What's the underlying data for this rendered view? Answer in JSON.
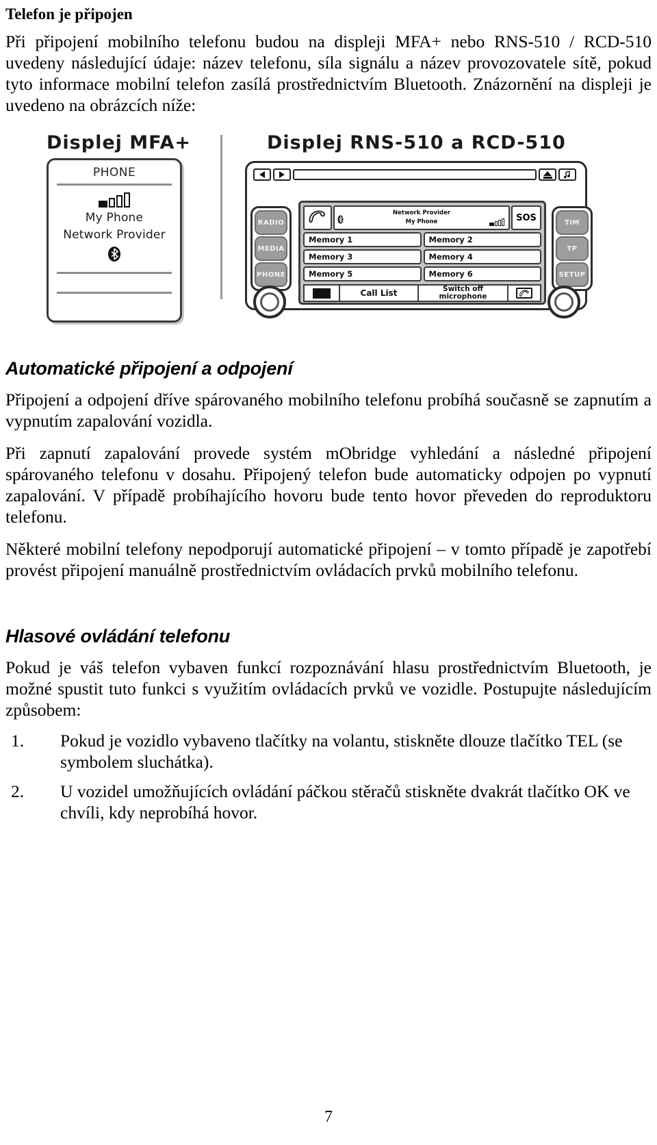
{
  "document": {
    "heading": "Telefon je připojen",
    "intro_paragraph": "Při připojení mobilního telefonu budou na displeji MFA+ nebo  RNS-510 / RCD-510 uvedeny následující údaje: název telefonu, síla signálu a název provozovatele sítě, pokud tyto informace mobilní telefon zasílá prostřednictvím Bluetooth. Znázornění na displeji je uvedeno na obrázcích níže:",
    "page_number": "7"
  },
  "figure": {
    "mfa_title": "Displej MFA+",
    "rns_title": "Displej RNS-510 a RCD-510",
    "mfa_display": {
      "title": "PHONE",
      "phone_name": "My Phone",
      "network_provider": "Network Provider",
      "bluetooth_icon": "bluetooth-icon",
      "signal_icon": "signal-strength-icon"
    },
    "rns_unit": {
      "left_buttons": [
        "RADIO",
        "MEDIA",
        "PHONE"
      ],
      "right_buttons": [
        "TIM",
        "TP",
        "SETUP"
      ],
      "top_bar": {
        "prev_icon": "previous-track-icon",
        "next_icon": "next-track-icon",
        "eject_icon": "eject-icon",
        "media_icon": "media-icon"
      },
      "screen": {
        "phone_icon": "handset-icon",
        "bluetooth_icon": "bluetooth-icon",
        "network_provider": "Network Provider",
        "phone_name": "My Phone",
        "signal_icon": "signal-strength-icon",
        "sos_label": "SOS",
        "memory_buttons": [
          "Memory 1",
          "Memory 2",
          "Memory 3",
          "Memory 4",
          "Memory 5",
          "Memory 6"
        ],
        "footer": {
          "left_icon": "black-block-icon",
          "call_list_label": "Call List",
          "switch_off_line1": "Switch off",
          "switch_off_line2": "microphone",
          "right_icon": "handset-button-icon"
        }
      },
      "knob_left_icon": "rotary-knob-icon",
      "knob_right_icon": "rotary-knob-icon"
    }
  },
  "section_auto": {
    "heading": "Automatické připojení a odpojení",
    "paragraphs": [
      "Připojení a odpojení dříve spárovaného mobilního telefonu probíhá současně se zapnutím a vypnutím zapalování vozidla.",
      "Při zapnutí zapalování provede systém mObridge vyhledání a následné připojení spárovaného telefonu v dosahu. Připojený telefon bude automaticky odpojen po vypnutí zapalování. V případě probíhajícího hovoru bude tento hovor převeden do reproduktoru telefonu.",
      "Některé mobilní telefony nepodporují automatické připojení – v tomto případě je zapotřebí provést připojení manuálně prostřednictvím ovládacích prvků mobilního telefonu."
    ]
  },
  "section_voice": {
    "heading": "Hlasové ovládání telefonu",
    "paragraphs": [
      "Pokud je váš telefon vybaven funkcí rozpoznávání hlasu prostřednictvím Bluetooth, je možné spustit tuto funkci s využitím ovládacích prvků ve vozidle. Postupujte následujícím způsobem:"
    ],
    "steps": [
      {
        "num": "1.",
        "text": "Pokud je vozidlo vybaveno tlačítky na volantu, stiskněte dlouze tlačítko TEL (se symbolem sluchátka)."
      },
      {
        "num": "2.",
        "text": "U vozidel umožňujících ovládání páčkou stěračů stiskněte dvakrát tlačítko OK ve chvíli, kdy neprobíhá hovor."
      }
    ]
  }
}
